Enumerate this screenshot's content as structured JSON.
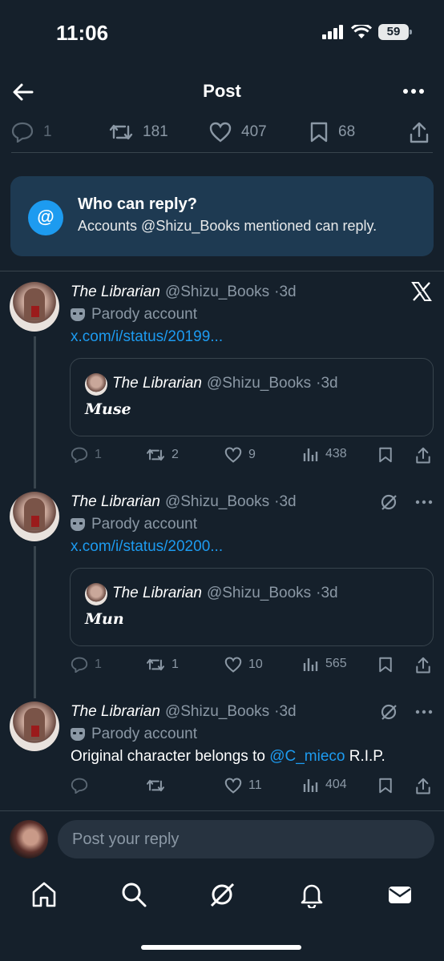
{
  "status": {
    "time": "11:06",
    "battery": "59"
  },
  "header": {
    "title": "Post"
  },
  "actions": {
    "replies": "1",
    "reposts": "181",
    "likes": "407",
    "bookmarks": "68"
  },
  "who_can_reply": {
    "title": "Who can reply?",
    "subtitle": "Accounts @Shizu_Books mentioned can reply."
  },
  "tweets": [
    {
      "name": "The Librarian",
      "handle": "@Shizu_Books",
      "time": "·3d",
      "parody": "Parody account",
      "link": "x.com/i/status/20199...",
      "quote": {
        "name": "The Librarian",
        "handle": "@Shizu_Books",
        "time": "·3d",
        "text": "Muse"
      },
      "stats": {
        "replies": "1",
        "reposts": "2",
        "likes": "9",
        "views": "438"
      }
    },
    {
      "name": "The Librarian",
      "handle": "@Shizu_Books",
      "time": "·3d",
      "parody": "Parody account",
      "link": "x.com/i/status/20200...",
      "quote": {
        "name": "The Librarian",
        "handle": "@Shizu_Books",
        "time": "·3d",
        "text": "Mun"
      },
      "stats": {
        "replies": "1",
        "reposts": "1",
        "likes": "10",
        "views": "565"
      }
    },
    {
      "name": "The Librarian",
      "handle": "@Shizu_Books",
      "time": "·3d",
      "parody": "Parody account",
      "text_pre": "Original character belongs to",
      "mention": "@C_mieco",
      "text_post": "R.I.P.",
      "stats": {
        "replies": "",
        "reposts": "",
        "likes": "11",
        "views": "404"
      }
    }
  ],
  "reply_bar": {
    "placeholder": "Post your reply"
  },
  "colors": {
    "background": "#15202b",
    "accent": "#1d9bf0",
    "muted": "#8b98a5",
    "card": "#1e3a52"
  }
}
